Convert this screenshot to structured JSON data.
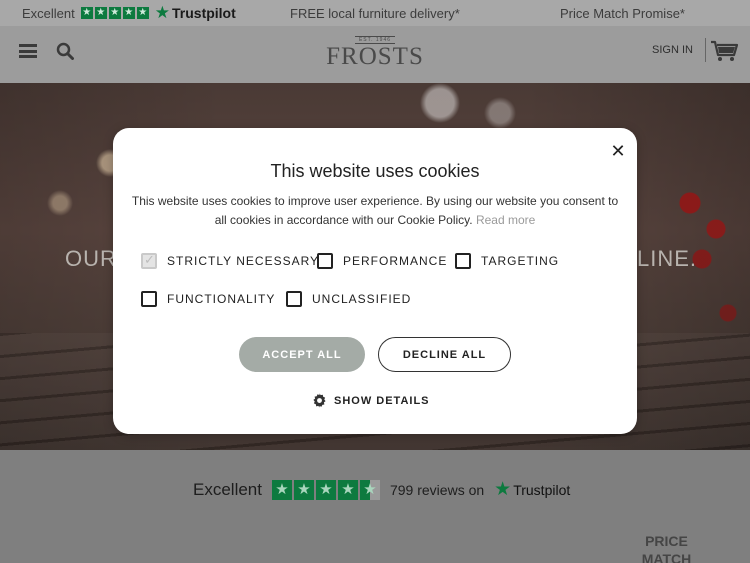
{
  "promo_bar": {
    "trustpilot_label": "Excellent",
    "trustpilot_brand": "Trustpilot",
    "delivery": "FREE local furniture delivery*",
    "price_match": "Price Match Promise*"
  },
  "header": {
    "logo_est": "EST. 1946",
    "logo_name": "FROSTS",
    "sign_in": "SIGN IN"
  },
  "hero": {
    "text_left": "OUR",
    "text_right": "LINE."
  },
  "trustpilot_widget": {
    "rating_label": "Excellent",
    "reviews": "799 reviews on",
    "brand": "Trustpilot",
    "rating_stars": 4.5
  },
  "price_match": {
    "line1": "PRICE",
    "line2": "MATCH"
  },
  "cookie_modal": {
    "title": "This website uses cookies",
    "body": "This website uses cookies to improve user experience. By using our website you consent to all cookies in accordance with our Cookie Policy.",
    "read_more": "Read more",
    "options": [
      {
        "label": "STRICTLY NECESSARY",
        "checked": true,
        "disabled": true
      },
      {
        "label": "PERFORMANCE",
        "checked": false
      },
      {
        "label": "TARGETING",
        "checked": false
      },
      {
        "label": "FUNCTIONALITY",
        "checked": false
      },
      {
        "label": "UNCLASSIFIED",
        "checked": false
      }
    ],
    "accept_label": "ACCEPT ALL",
    "decline_label": "DECLINE ALL",
    "show_details_label": "SHOW DETAILS",
    "close_glyph": "✕"
  },
  "colors": {
    "trustpilot_green": "#0d7a3f",
    "accept_button": "#a4aba6"
  }
}
